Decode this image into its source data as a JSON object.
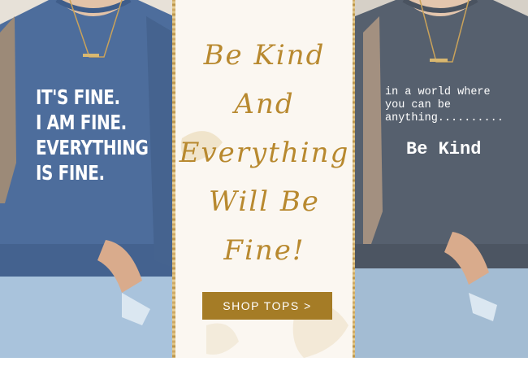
{
  "left_shirt": {
    "text": "IT'S FINE.\nI AM FINE.\nEVERYTHING\nIS FINE.",
    "color": "#4a6a98"
  },
  "right_shirt": {
    "text_small": "in a world where\nyou can be\nanything..........",
    "text_big": "Be Kind",
    "color": "#555f6e"
  },
  "headline": {
    "line1": "Be Kind",
    "line2": "And",
    "line3": "Everything",
    "line4": "Will Be",
    "line5": "Fine!"
  },
  "cta": {
    "label": "SHOP TOPS >",
    "color": "#a57c26"
  },
  "accent": "#b8892f"
}
